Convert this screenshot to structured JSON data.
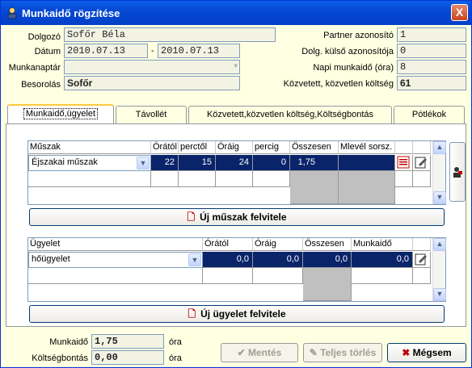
{
  "window": {
    "title": "Munkaidő rögzítése",
    "close_glyph": "X"
  },
  "header": {
    "dolgozo_label": "Dolgozó",
    "dolgozo_value": "Sofőr Béla",
    "datum_label": "Dátum",
    "datum_from": "2010.07.13",
    "datum_sep": "-",
    "datum_to": "2010.07.13",
    "munkanaptar_label": "Munkanaptár",
    "munkanaptar_value": "",
    "besorolas_label": "Besorolás",
    "besorolas_value": "Sofőr",
    "partner_label": "Partner azonosító",
    "partner_value": "1",
    "kulso_label": "Dolg. külső azonosítója",
    "kulso_value": "0",
    "napi_label": "Napi munkaidő (óra)",
    "napi_value": "8",
    "koltseg_label": "Közvetett, közvetlen költség",
    "koltseg_value": "61"
  },
  "tabs": [
    "Munkaidő,ügyelet",
    "Távollét",
    "Közvetett,közvetlen költség,Költségbontás",
    "Pótlékok"
  ],
  "shift_grid": {
    "headers": [
      "Műszak",
      "Órától",
      "perctől",
      "Óráig",
      "percig",
      "Összesen",
      "Mlevél sorsz."
    ],
    "row": {
      "muszak": "Éjszakai műszak",
      "oratol": "22",
      "perctol": "15",
      "oraig": "24",
      "percig": "0",
      "osszesen": "1,75",
      "mlevel": ""
    },
    "new_button": "Új műszak felvitele"
  },
  "duty_grid": {
    "headers": [
      "Ügyelet",
      "Órától",
      "Óráig",
      "Összesen",
      "Munkaidő"
    ],
    "row": {
      "ugyelet": "hőügyelet",
      "oratol": "0,0",
      "oraig": "0,0",
      "osszesen": "0,0",
      "munkaido": "0,0"
    },
    "new_button": "Új ügyelet felvitele"
  },
  "footer": {
    "munkaido_label": "Munkaidő",
    "munkaido_value": "1,75",
    "munkaido_unit": "óra",
    "koltsegbontas_label": "Költségbontás",
    "koltsegbontas_value": "0,00",
    "koltsegbontas_unit": "óra",
    "save": "Mentés",
    "delete_all": "Teljes törlés",
    "cancel": "Mégsem"
  }
}
